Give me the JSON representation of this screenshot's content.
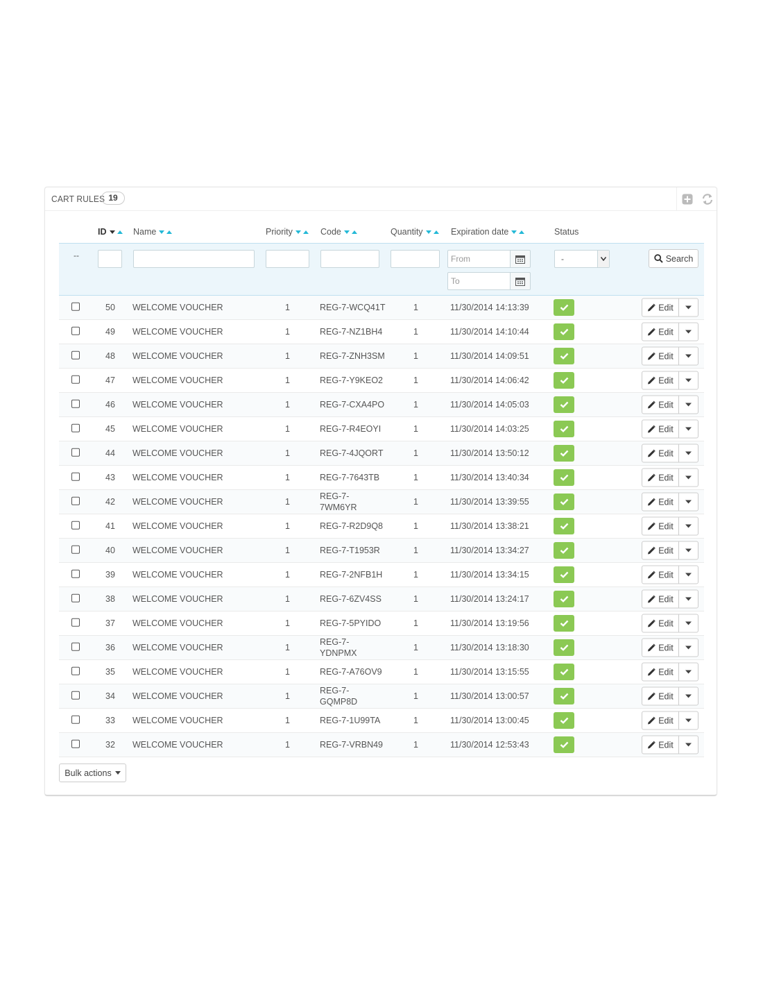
{
  "panel": {
    "title": "CART RULES",
    "count": "19",
    "toolbar": {
      "add_icon": "plus-square-icon",
      "refresh_icon": "refresh-icon"
    }
  },
  "columns": {
    "id": "ID",
    "name": "Name",
    "priority": "Priority",
    "code": "Code",
    "quantity": "Quantity",
    "expiration": "Expiration date",
    "status": "Status"
  },
  "filters": {
    "dashes": "--",
    "from_placeholder": "From",
    "to_placeholder": "To",
    "status_value": "-",
    "search_label": "Search"
  },
  "rows": [
    {
      "id": "50",
      "name": "WELCOME VOUCHER",
      "priority": "1",
      "code": "REG-7-WCQ41T",
      "quantity": "1",
      "expiration": "11/30/2014 14:13:39"
    },
    {
      "id": "49",
      "name": "WELCOME VOUCHER",
      "priority": "1",
      "code": "REG-7-NZ1BH4",
      "quantity": "1",
      "expiration": "11/30/2014 14:10:44"
    },
    {
      "id": "48",
      "name": "WELCOME VOUCHER",
      "priority": "1",
      "code": "REG-7-ZNH3SM",
      "quantity": "1",
      "expiration": "11/30/2014 14:09:51"
    },
    {
      "id": "47",
      "name": "WELCOME VOUCHER",
      "priority": "1",
      "code": "REG-7-Y9KEO2",
      "quantity": "1",
      "expiration": "11/30/2014 14:06:42"
    },
    {
      "id": "46",
      "name": "WELCOME VOUCHER",
      "priority": "1",
      "code": "REG-7-CXA4PO",
      "quantity": "1",
      "expiration": "11/30/2014 14:05:03"
    },
    {
      "id": "45",
      "name": "WELCOME VOUCHER",
      "priority": "1",
      "code": "REG-7-R4EOYI",
      "quantity": "1",
      "expiration": "11/30/2014 14:03:25"
    },
    {
      "id": "44",
      "name": "WELCOME VOUCHER",
      "priority": "1",
      "code": "REG-7-4JQORT",
      "quantity": "1",
      "expiration": "11/30/2014 13:50:12"
    },
    {
      "id": "43",
      "name": "WELCOME VOUCHER",
      "priority": "1",
      "code": "REG-7-7643TB",
      "quantity": "1",
      "expiration": "11/30/2014 13:40:34"
    },
    {
      "id": "42",
      "name": "WELCOME VOUCHER",
      "priority": "1",
      "code": "REG-7-7WM6YR",
      "quantity": "1",
      "expiration": "11/30/2014 13:39:55"
    },
    {
      "id": "41",
      "name": "WELCOME VOUCHER",
      "priority": "1",
      "code": "REG-7-R2D9Q8",
      "quantity": "1",
      "expiration": "11/30/2014 13:38:21"
    },
    {
      "id": "40",
      "name": "WELCOME VOUCHER",
      "priority": "1",
      "code": "REG-7-T1953R",
      "quantity": "1",
      "expiration": "11/30/2014 13:34:27"
    },
    {
      "id": "39",
      "name": "WELCOME VOUCHER",
      "priority": "1",
      "code": "REG-7-2NFB1H",
      "quantity": "1",
      "expiration": "11/30/2014 13:34:15"
    },
    {
      "id": "38",
      "name": "WELCOME VOUCHER",
      "priority": "1",
      "code": "REG-7-6ZV4SS",
      "quantity": "1",
      "expiration": "11/30/2014 13:24:17"
    },
    {
      "id": "37",
      "name": "WELCOME VOUCHER",
      "priority": "1",
      "code": "REG-7-5PYIDO",
      "quantity": "1",
      "expiration": "11/30/2014 13:19:56"
    },
    {
      "id": "36",
      "name": "WELCOME VOUCHER",
      "priority": "1",
      "code": "REG-7-YDNPMX",
      "quantity": "1",
      "expiration": "11/30/2014 13:18:30"
    },
    {
      "id": "35",
      "name": "WELCOME VOUCHER",
      "priority": "1",
      "code": "REG-7-A76OV9",
      "quantity": "1",
      "expiration": "11/30/2014 13:15:55"
    },
    {
      "id": "34",
      "name": "WELCOME VOUCHER",
      "priority": "1",
      "code": "REG-7-GQMP8D",
      "quantity": "1",
      "expiration": "11/30/2014 13:00:57"
    },
    {
      "id": "33",
      "name": "WELCOME VOUCHER",
      "priority": "1",
      "code": "REG-7-1U99TA",
      "quantity": "1",
      "expiration": "11/30/2014 13:00:45"
    },
    {
      "id": "32",
      "name": "WELCOME VOUCHER",
      "priority": "1",
      "code": "REG-7-VRBN49",
      "quantity": "1",
      "expiration": "11/30/2014 12:53:43"
    }
  ],
  "row_actions": {
    "edit_label": "Edit",
    "edit_icon": "pencil-icon",
    "status_icon": "check-icon"
  },
  "bulk_actions_label": "Bulk actions",
  "colors": {
    "accent": "#25b9d7",
    "status_ok": "#8bc954",
    "filter_bg": "#ecf6fb"
  }
}
